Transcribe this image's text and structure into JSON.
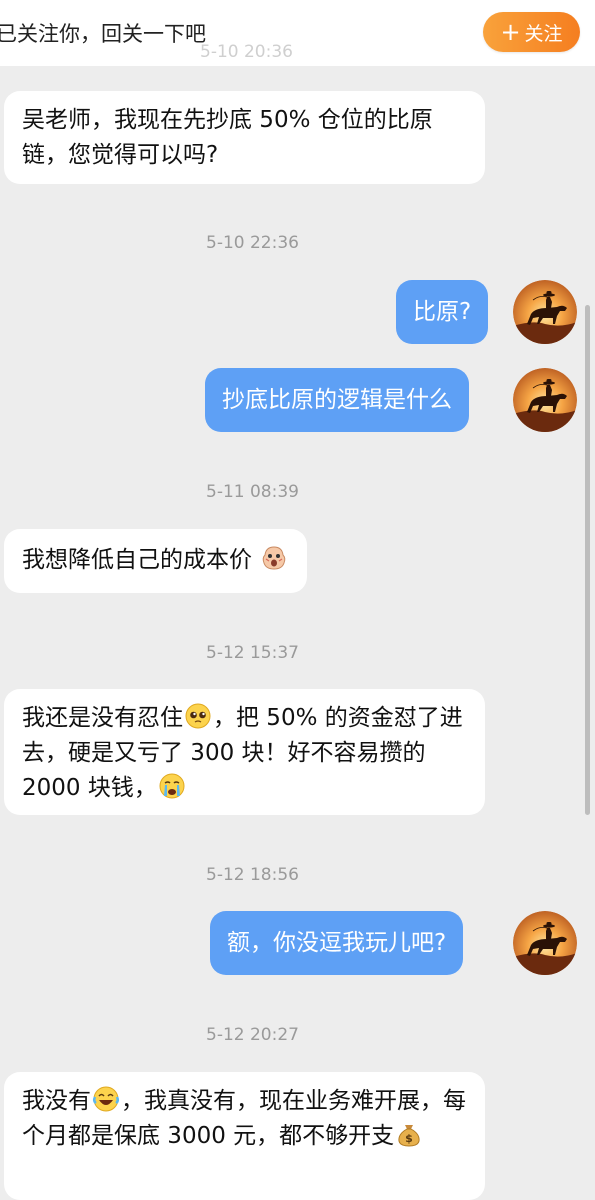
{
  "header": {
    "follow_prompt": "已关注你，回关一下吧",
    "follow_button": "关注",
    "follow_plus": "+",
    "ghost_time": "5-10 20:36"
  },
  "messages": [
    {
      "type": "received",
      "text": "吴老师，我现在先抄底 50% 仓位的比原链，您觉得可以吗?"
    },
    {
      "type": "time",
      "text": "5-10 22:36"
    },
    {
      "type": "sent",
      "text": "比原?"
    },
    {
      "type": "sent",
      "text": "抄底比原的逻辑是什么"
    },
    {
      "type": "time",
      "text": "5-11 08:39"
    },
    {
      "type": "received",
      "text": "我想降低自己的成本价"
    },
    {
      "type": "time",
      "text": "5-12 15:37"
    },
    {
      "type": "received",
      "parts": [
        "我还是没有忍住",
        "，把 50% 的资金怼了进去，硬是又亏了 300 块！好不容易攒的 2000 块钱，"
      ]
    },
    {
      "type": "time",
      "text": "5-12 18:56"
    },
    {
      "type": "sent",
      "text": "额，你没逗我玩儿吧?"
    },
    {
      "type": "time",
      "text": "5-12 20:27"
    },
    {
      "type": "received",
      "parts": [
        "我没有",
        "，我真没有，现在业务难开展，每个月都是保底 3000 元，都不够开支"
      ]
    }
  ],
  "icons": {
    "avatar": "cowboy-horse-sunset-avatar",
    "emoji_1": "scared-face-emoji",
    "emoji_2": "pleading-face-emoji",
    "emoji_3": "crying-face-emoji",
    "emoji_4": "laughing-tears-emoji",
    "emoji_5": "money-bag-emoji"
  },
  "colors": {
    "sent_bubble": "#5ea0f5",
    "received_bubble": "#ffffff",
    "follow_button": "#f68a2a",
    "background": "#ededed"
  }
}
